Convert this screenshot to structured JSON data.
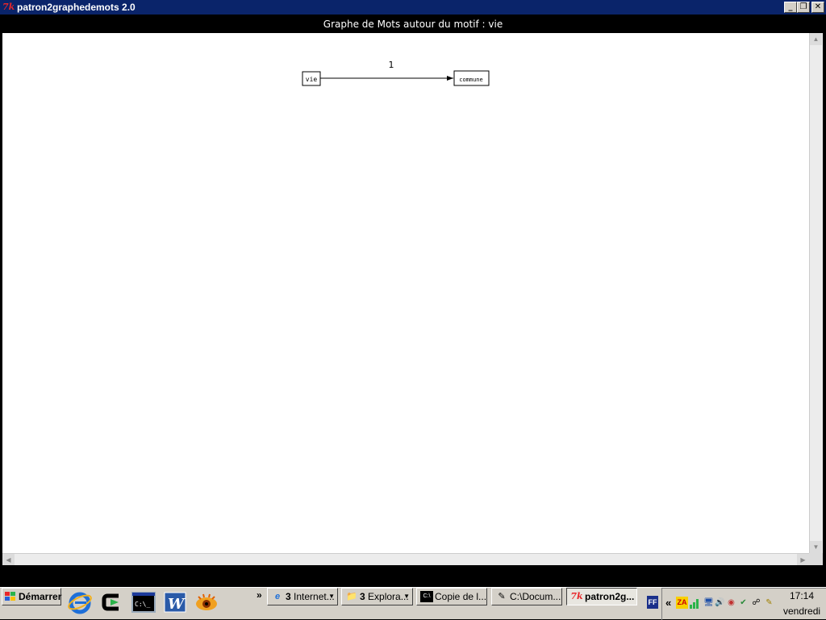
{
  "window": {
    "title": "patron2graphedemots 2.0",
    "app_icon_text": "7k",
    "minimize": "_",
    "maximize": "❐",
    "close": "✕"
  },
  "header": {
    "text": "Graphe de Mots autour du motif : vie"
  },
  "graph": {
    "source_node": "vie",
    "target_node": "commune",
    "edge_weight": "1"
  },
  "taskbar": {
    "start_label": "Démarrer",
    "chevron": "»",
    "tasks": [
      {
        "count": "3",
        "label": "Internet...",
        "icon": "e"
      },
      {
        "count": "3",
        "label": "Explora...",
        "icon": "📁"
      },
      {
        "count": "",
        "label": "Copie de l...",
        "icon": "C:\\"
      },
      {
        "count": "",
        "label": "C:\\Docum...",
        "icon": "✎"
      },
      {
        "count": "",
        "label": "patron2g...",
        "icon": "7k"
      }
    ],
    "ff_icon": "FF",
    "tray_chevron": "«",
    "clock_time": "17:14",
    "clock_day": "vendredi"
  },
  "colors": {
    "titlebar": "#0a246a",
    "taskbar": "#d4d0c8",
    "tk_red": "#e8262a"
  }
}
